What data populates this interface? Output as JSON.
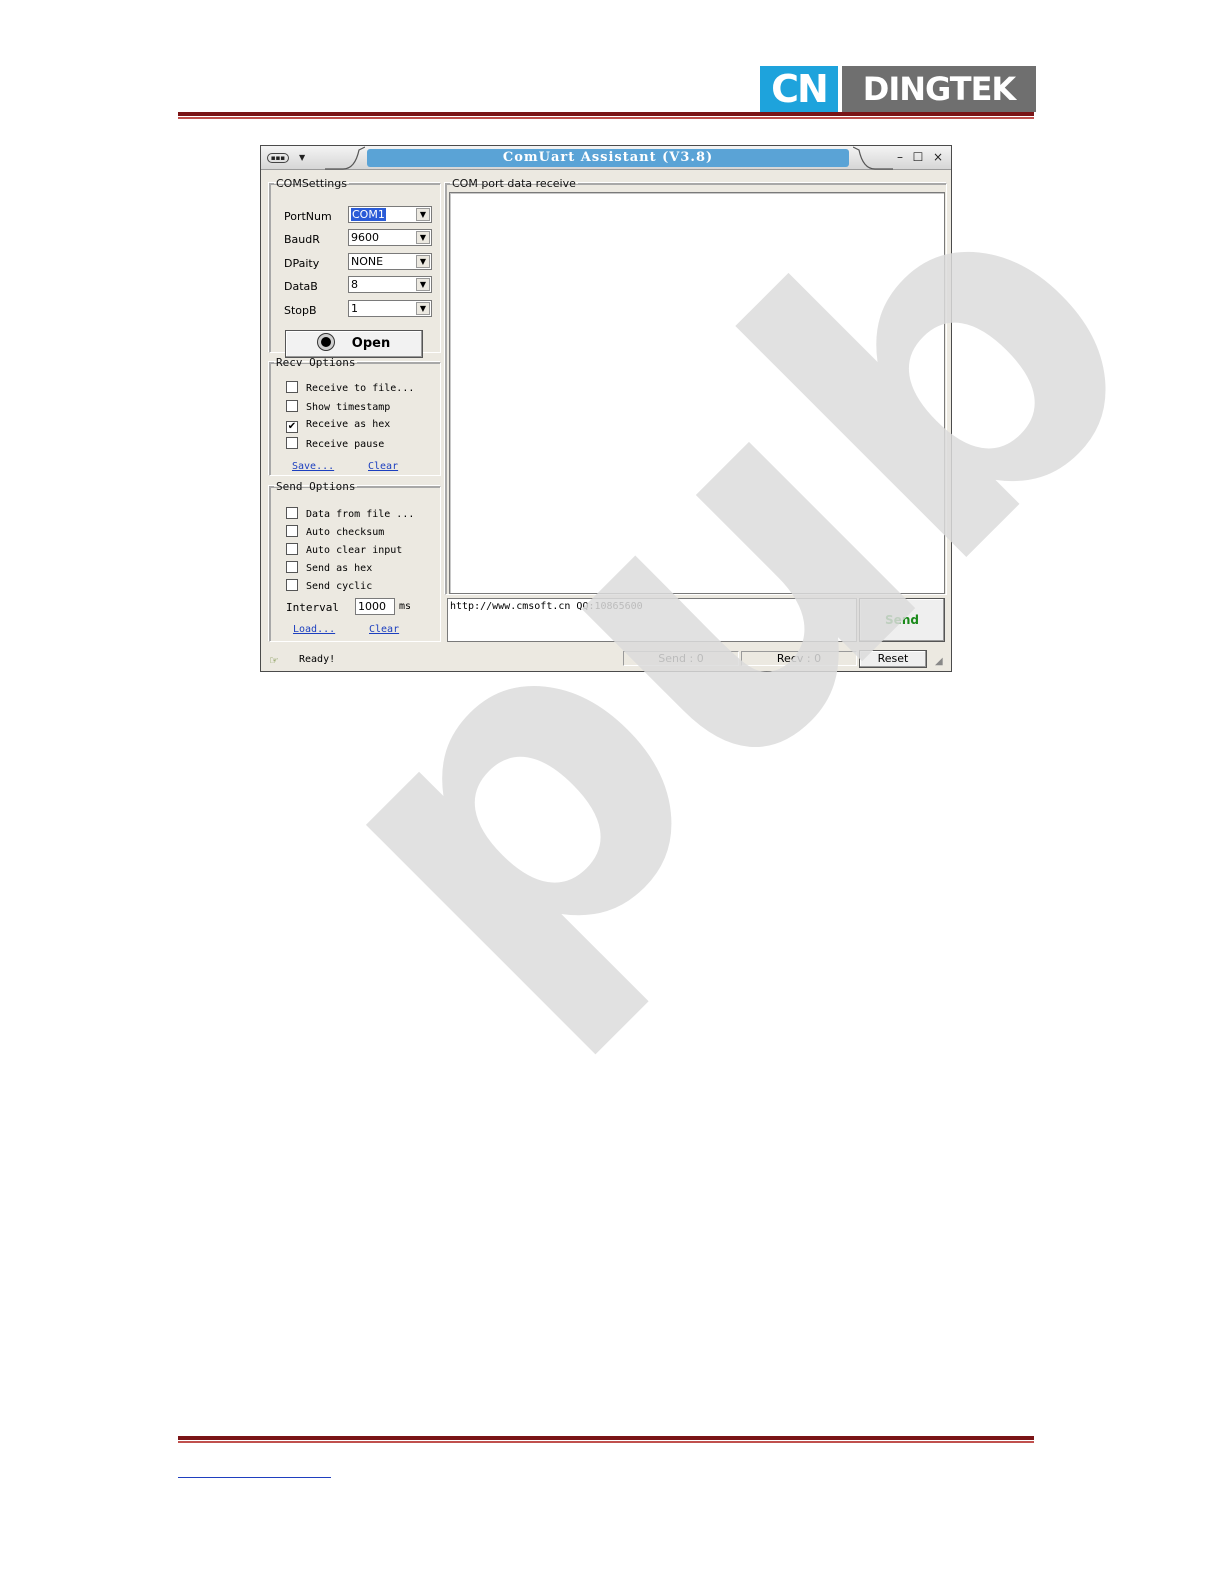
{
  "logo": {
    "cn": "CN",
    "brand": "DINGTEK"
  },
  "watermark": "pub",
  "window": {
    "title": "ComUart Assistant (V3.8)",
    "minimize_glyph": "–",
    "maximize_glyph": "☐",
    "close_glyph": "×"
  },
  "com_settings": {
    "legend": "COMSettings",
    "fields": [
      {
        "label": "PortNum",
        "value": "COM1"
      },
      {
        "label": "BaudR",
        "value": "9600"
      },
      {
        "label": "DPaity",
        "value": "NONE"
      },
      {
        "label": "DataB",
        "value": "8"
      },
      {
        "label": "StopB",
        "value": "1"
      }
    ],
    "open_label": "Open"
  },
  "recv_options": {
    "legend": "Recv Options",
    "items": [
      {
        "label": "Receive to file...",
        "checked": false
      },
      {
        "label": "Show timestamp",
        "checked": false
      },
      {
        "label": "Receive as hex",
        "checked": true
      },
      {
        "label": "Receive pause",
        "checked": false
      }
    ],
    "save_link": "Save...",
    "clear_link": "Clear"
  },
  "send_options": {
    "legend": "Send Options",
    "items": [
      {
        "label": "Data from file ...",
        "checked": false
      },
      {
        "label": "Auto checksum",
        "checked": false
      },
      {
        "label": "Auto clear input",
        "checked": false
      },
      {
        "label": "Send as hex",
        "checked": false
      },
      {
        "label": "Send cyclic",
        "checked": false
      }
    ],
    "interval_label": "Interval",
    "interval_value": "1000",
    "interval_unit": "ms",
    "load_link": "Load...",
    "clear_link": "Clear"
  },
  "receive_panel": {
    "legend": "COM port data receive"
  },
  "send_panel": {
    "input_text": "http://www.cmsoft.cn QQ:10865600",
    "send_label": "Send"
  },
  "status": {
    "text": "Ready!",
    "send_counter": "Send : 0",
    "recv_counter": "Recv : 0",
    "reset_label": "Reset"
  },
  "checkmark": "✔"
}
